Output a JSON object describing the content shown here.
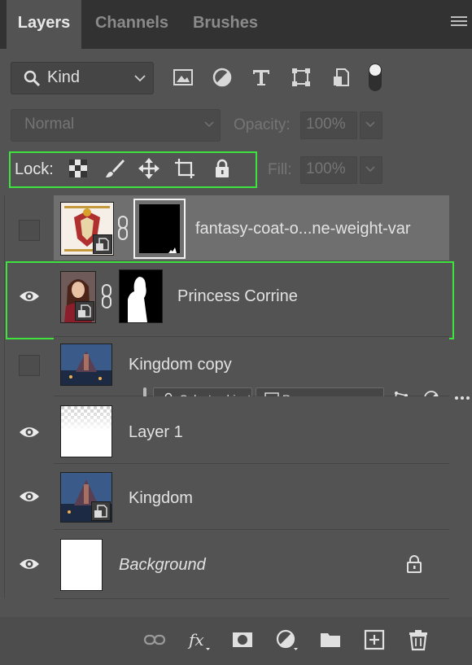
{
  "tabs": [
    "Layers",
    "Channels",
    "Brushes"
  ],
  "filter": {
    "kind_label": "Kind",
    "icons": [
      "image-filter-icon",
      "adjustment-filter-icon",
      "type-filter-icon",
      "shape-filter-icon",
      "smart-object-filter-icon",
      "filter-toggle-icon"
    ]
  },
  "blend": {
    "mode": "Normal",
    "opacity_label": "Opacity:",
    "opacity_value": "100%"
  },
  "lock": {
    "label": "Lock:",
    "fill_label": "Fill:",
    "fill_value": "100%"
  },
  "layers": [
    {
      "name": "fantasy-coat-o...ne-weight-var",
      "visible": false,
      "has_mask": true,
      "selected": true
    },
    {
      "name": "Princess Corrine",
      "visible": true,
      "has_mask": true,
      "selected": false
    },
    {
      "name": "Kingdom copy",
      "visible": false,
      "has_mask": false,
      "selected": false
    },
    {
      "name": "Layer 1",
      "visible": true,
      "has_mask": false,
      "selected": false
    },
    {
      "name": "Kingdom",
      "visible": true,
      "has_mask": false,
      "selected": false
    },
    {
      "name": "Background",
      "visible": true,
      "has_mask": false,
      "selected": false,
      "locked": true
    }
  ],
  "context_bar": {
    "select_subject": "Select subject",
    "remove_background": "Remove background"
  },
  "colors": {
    "accent_green": "#3ee43e",
    "panel": "#535353",
    "tab_bg": "#323232"
  }
}
